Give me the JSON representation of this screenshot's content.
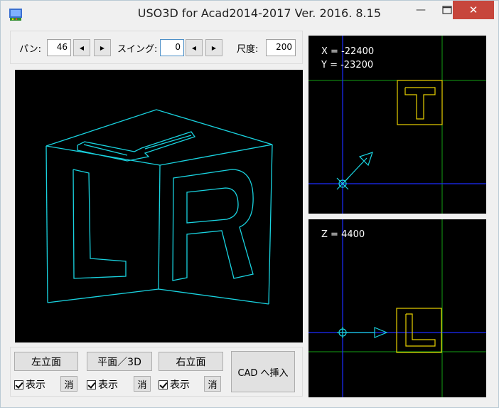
{
  "window": {
    "title": "USO3D for Acad2014-2017 Ver. 2016. 8.15",
    "minimize_glyph": "—",
    "close_glyph": "✕"
  },
  "controls": {
    "pan_label": "パン:",
    "pan_value": "46",
    "swing_label": "スイング:",
    "swing_value": "0",
    "scale_label": "尺度:",
    "scale_value": "200",
    "spin_left": "◀",
    "spin_right": "▶"
  },
  "top_view": {
    "x_readout": "X = -22400",
    "y_readout": "Y = -23200",
    "marker_letter": "T"
  },
  "front_view": {
    "z_readout": "Z = 4400",
    "marker_letter": "L"
  },
  "buttons": {
    "left_elevation": "左立面",
    "plan_3d": "平面／3D",
    "right_elevation": "右立面",
    "show_label": "表示",
    "delete_label": "消",
    "insert_cad": "CAD へ挿入"
  },
  "colors": {
    "wire": "#19d3e0",
    "axis_blue": "#1c2cff",
    "grid_green": "#14a014",
    "marker_yellow": "#e8d000",
    "close_red": "#c7463c"
  }
}
